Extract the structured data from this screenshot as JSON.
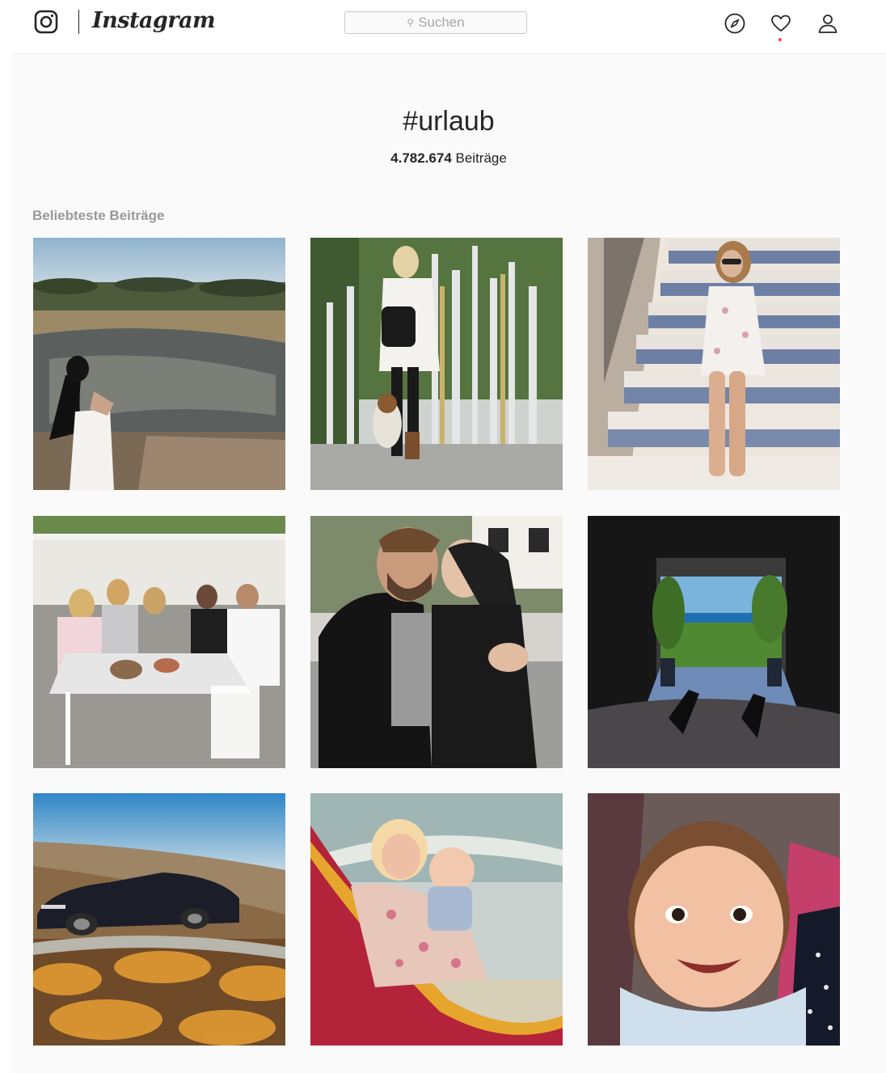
{
  "header": {
    "logo_text": "Instagram",
    "search_placeholder": "Suchen",
    "icons": [
      "instagram-camera-icon",
      "compass-icon",
      "heart-icon",
      "user-icon"
    ],
    "notification_color": "#ed4956"
  },
  "hashtag": {
    "title": "#urlaub",
    "count_number": "4.782.674",
    "count_label": "Beiträge"
  },
  "section": {
    "title": "Beliebteste Beiträge"
  },
  "posts": [
    {
      "subject": "woman-river-savanna"
    },
    {
      "subject": "woman-dog-harbor"
    },
    {
      "subject": "woman-tiled-stairs"
    },
    {
      "subject": "family-dinner-table"
    },
    {
      "subject": "couple-kissing"
    },
    {
      "subject": "ocean-view-window"
    },
    {
      "subject": "convertible-car"
    },
    {
      "subject": "woman-baby-hammock"
    },
    {
      "subject": "smiling-baby"
    }
  ],
  "colors": {
    "text": "#262626",
    "muted": "#999999",
    "background": "#fafafa"
  }
}
